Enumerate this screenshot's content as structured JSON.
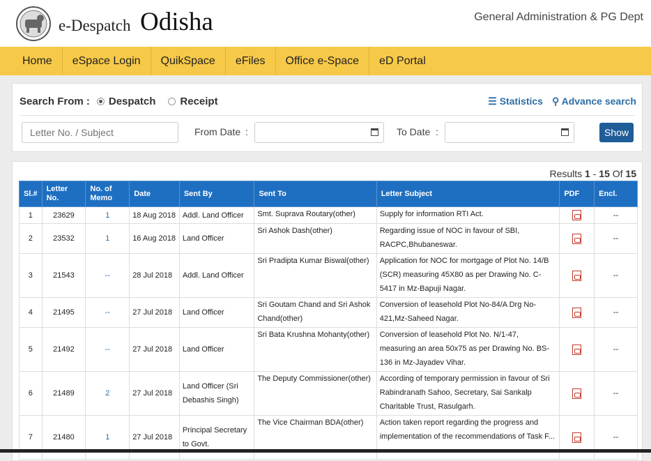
{
  "header": {
    "brand_small": "e-Despatch",
    "brand_big": "Odisha",
    "department": "General Administration & PG Dept"
  },
  "nav": [
    "Home",
    "eSpace Login",
    "QuikSpace",
    "eFiles",
    "Office e-Space",
    "eD Portal"
  ],
  "search": {
    "search_from_label": "Search From :",
    "option_despatch": "Despatch",
    "option_receipt": "Receipt",
    "selected": "Despatch",
    "statistics_label": "Statistics",
    "advance_search_label": "Advance search",
    "letter_placeholder": "Letter No. / Subject",
    "from_date_label": "From Date",
    "to_date_label": "To Date",
    "colon": ":",
    "show_label": "Show"
  },
  "results": {
    "prefix": "Results",
    "from": "1",
    "dash": "-",
    "to": "15",
    "of_label": "Of",
    "total": "15"
  },
  "table": {
    "headers": [
      "Sl.#",
      "Letter No.",
      "No. of Memo",
      "Date",
      "Sent By",
      "Sent To",
      "Letter Subject",
      "PDF",
      "Encl."
    ],
    "rows": [
      {
        "sl": "1",
        "letter": "23629",
        "memo": "1",
        "date": "18 Aug 2018",
        "by": "Addl. Land Officer",
        "to": "Smt. Suprava Routary(other)",
        "subject": "Supply for information RTI Act.",
        "encl": "--"
      },
      {
        "sl": "2",
        "letter": "23532",
        "memo": "1",
        "date": "16 Aug 2018",
        "by": "Land Officer",
        "to": "Sri Ashok Dash(other)",
        "subject": "Regarding issue of NOC in favour of SBI, RACPC,Bhubaneswar.",
        "encl": "--"
      },
      {
        "sl": "3",
        "letter": "21543",
        "memo": "--",
        "date": "28 Jul 2018",
        "by": "Addl. Land Officer",
        "to": "Sri Pradipta Kumar Biswal(other)",
        "subject": "Application for NOC for mortgage of Plot No. 14/B (SCR) measuring 45X80 as per Drawing No. C-5417 in Mz-Bapuji Nagar.",
        "encl": "--"
      },
      {
        "sl": "4",
        "letter": "21495",
        "memo": "--",
        "date": "27 Jul 2018",
        "by": "Land Officer",
        "to": "Sri Goutam Chand and Sri Ashok Chand(other)",
        "subject": "Conversion of leasehold Plot No-84/A Drg No-421,Mz-Saheed Nagar.",
        "encl": "--"
      },
      {
        "sl": "5",
        "letter": "21492",
        "memo": "--",
        "date": "27 Jul 2018",
        "by": "Land Officer",
        "to": "Sri Bata Krushna Mohanty(other)",
        "subject": "Conversion of leasehold Plot No. N/1-47, measuring an area 50x75 as per Drawing No. BS-136 in Mz-Jayadev Vihar.",
        "encl": "--"
      },
      {
        "sl": "6",
        "letter": "21489",
        "memo": "2",
        "date": "27 Jul 2018",
        "by": "Land Officer (Sri Debashis Singh)",
        "to": "The Deputy Commissioner(other)",
        "subject": "According of temporary permission in favour of Sri Rabindranath Sahoo, Secretary, Sai Sankalp Charitable Trust, Rasulgarh.",
        "encl": "--"
      },
      {
        "sl": "7",
        "letter": "21480",
        "memo": "1",
        "date": "27 Jul 2018",
        "by": "Principal Secretary to Govt.",
        "to": "The Vice Chairman BDA(other)",
        "subject": "Action taken report regarding the progress and implementation of the recommendations of Task F...",
        "encl": "--"
      }
    ]
  }
}
